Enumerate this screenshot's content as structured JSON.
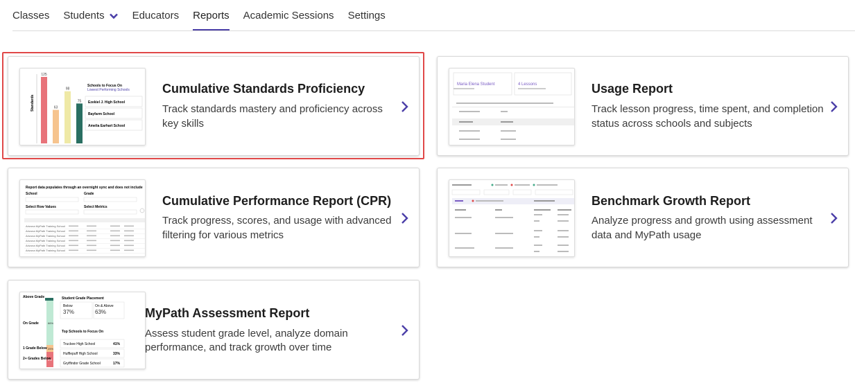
{
  "nav": {
    "items": [
      {
        "label": "Classes"
      },
      {
        "label": "Students"
      },
      {
        "label": "Educators"
      },
      {
        "label": "Reports"
      },
      {
        "label": "Academic Sessions"
      },
      {
        "label": "Settings"
      }
    ],
    "active": "Reports"
  },
  "cards": [
    {
      "title": "Cumulative Standards Proficiency",
      "desc1": "Track standards mastery and proficiency across",
      "desc2": "key skills",
      "selected": true
    },
    {
      "title": "Usage Report",
      "desc1": "Track lesson progress, time spent, and completion",
      "desc2": "status across schools and subjects"
    },
    {
      "title": "Cumulative Performance Report (CPR)",
      "desc1": "Track progress, scores, and usage with advanced",
      "desc2": "filtering for various metrics"
    },
    {
      "title": "Benchmark Growth Report",
      "desc1": "Analyze progress and growth using assessment",
      "desc2": "data and MyPath usage"
    },
    {
      "title": "MyPath Assessment Report",
      "desc1": "Assess student grade level, analyze domain",
      "desc2": "performance, and track growth over time"
    }
  ],
  "thumbs": {
    "csp": {
      "ylabel": "Standards",
      "bars": [
        125,
        63,
        98,
        75
      ],
      "bar_colors": [
        "#e8737a",
        "#f6c48e",
        "#efe9a6",
        "#2a6f62"
      ],
      "heading": "Schools to Focus On",
      "subheading": "Lowest Performing Schools",
      "schools": [
        "Ezekiel J. High School",
        "Bayfarm School",
        "Amelia Earhart School"
      ]
    },
    "usage": {
      "student": "Maria Elena Student",
      "lessons": "4 Lessons"
    },
    "cpr": {
      "note": "Report data populates through an overnight sync and does not include",
      "f1": "School",
      "f2": "Grade",
      "f3": "Select Row Values",
      "f4": "Select Metrics",
      "rows": [
        "Arizona MyPath Training School",
        "Arizona MyPath Training School",
        "Arizona MyPath Training School",
        "Arizona MyPath Training School",
        "Arizona MyPath Training School",
        "Arizona MyPath Training School"
      ]
    },
    "mypath": {
      "title": "Student Grade Placement",
      "below": "Below",
      "below_val": "37%",
      "on": "On & Above",
      "on_val": "63%",
      "focus": "Top Schools to Focus On",
      "schools": [
        "Truckee High School",
        "Hufflepuff High School",
        "Gryffindor Grade School"
      ],
      "pcts": [
        "41%",
        "33%",
        "17%"
      ],
      "labels": [
        "Above Grade",
        "On Grade",
        "1 Grade Below",
        "2+ Grades Below"
      ]
    }
  },
  "colors": {
    "accent": "#4b3fa8",
    "highlight": "#e04848"
  }
}
